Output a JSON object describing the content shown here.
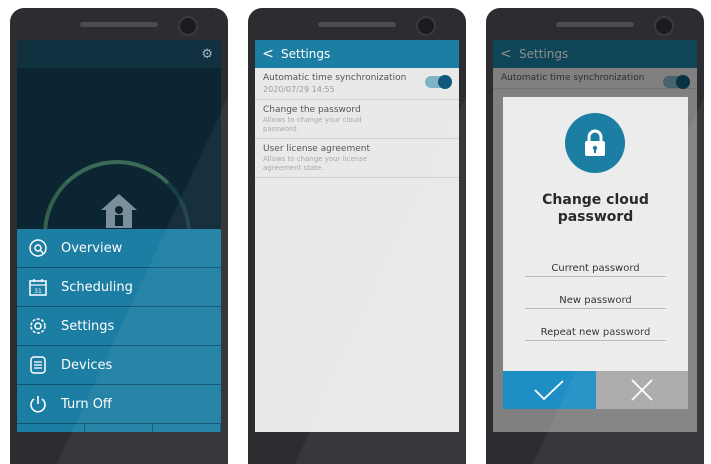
{
  "screen1": {
    "menu": [
      {
        "label": "Overview",
        "icon": "overview-icon"
      },
      {
        "label": "Scheduling",
        "icon": "calendar-icon",
        "icon_text": "31"
      },
      {
        "label": "Settings",
        "icon": "gear-icon"
      },
      {
        "label": "Devices",
        "icon": "devices-list-icon"
      },
      {
        "label": "Turn Off",
        "icon": "power-icon"
      }
    ]
  },
  "screen2": {
    "header_title": "Settings",
    "items": [
      {
        "title": "Automatic time synchronization",
        "value": "2020/07/29 14:55",
        "toggle_on": true
      },
      {
        "title": "Change the password",
        "subtitle": "Allows to change your cloud password."
      },
      {
        "title": "User license agreement",
        "subtitle": "Allows to change your license agreement state."
      }
    ]
  },
  "screen3": {
    "header_title": "Settings",
    "bg_item_title": "Automatic time synchronization",
    "dialog": {
      "title": "Change cloud password",
      "fields": [
        "Current password",
        "New password",
        "Repeat new password"
      ]
    }
  },
  "colors": {
    "accent": "#1b7ea2",
    "ok": "#1e8fc4",
    "cancel": "#a9a9a9",
    "dark_bg": "#0c2533"
  }
}
